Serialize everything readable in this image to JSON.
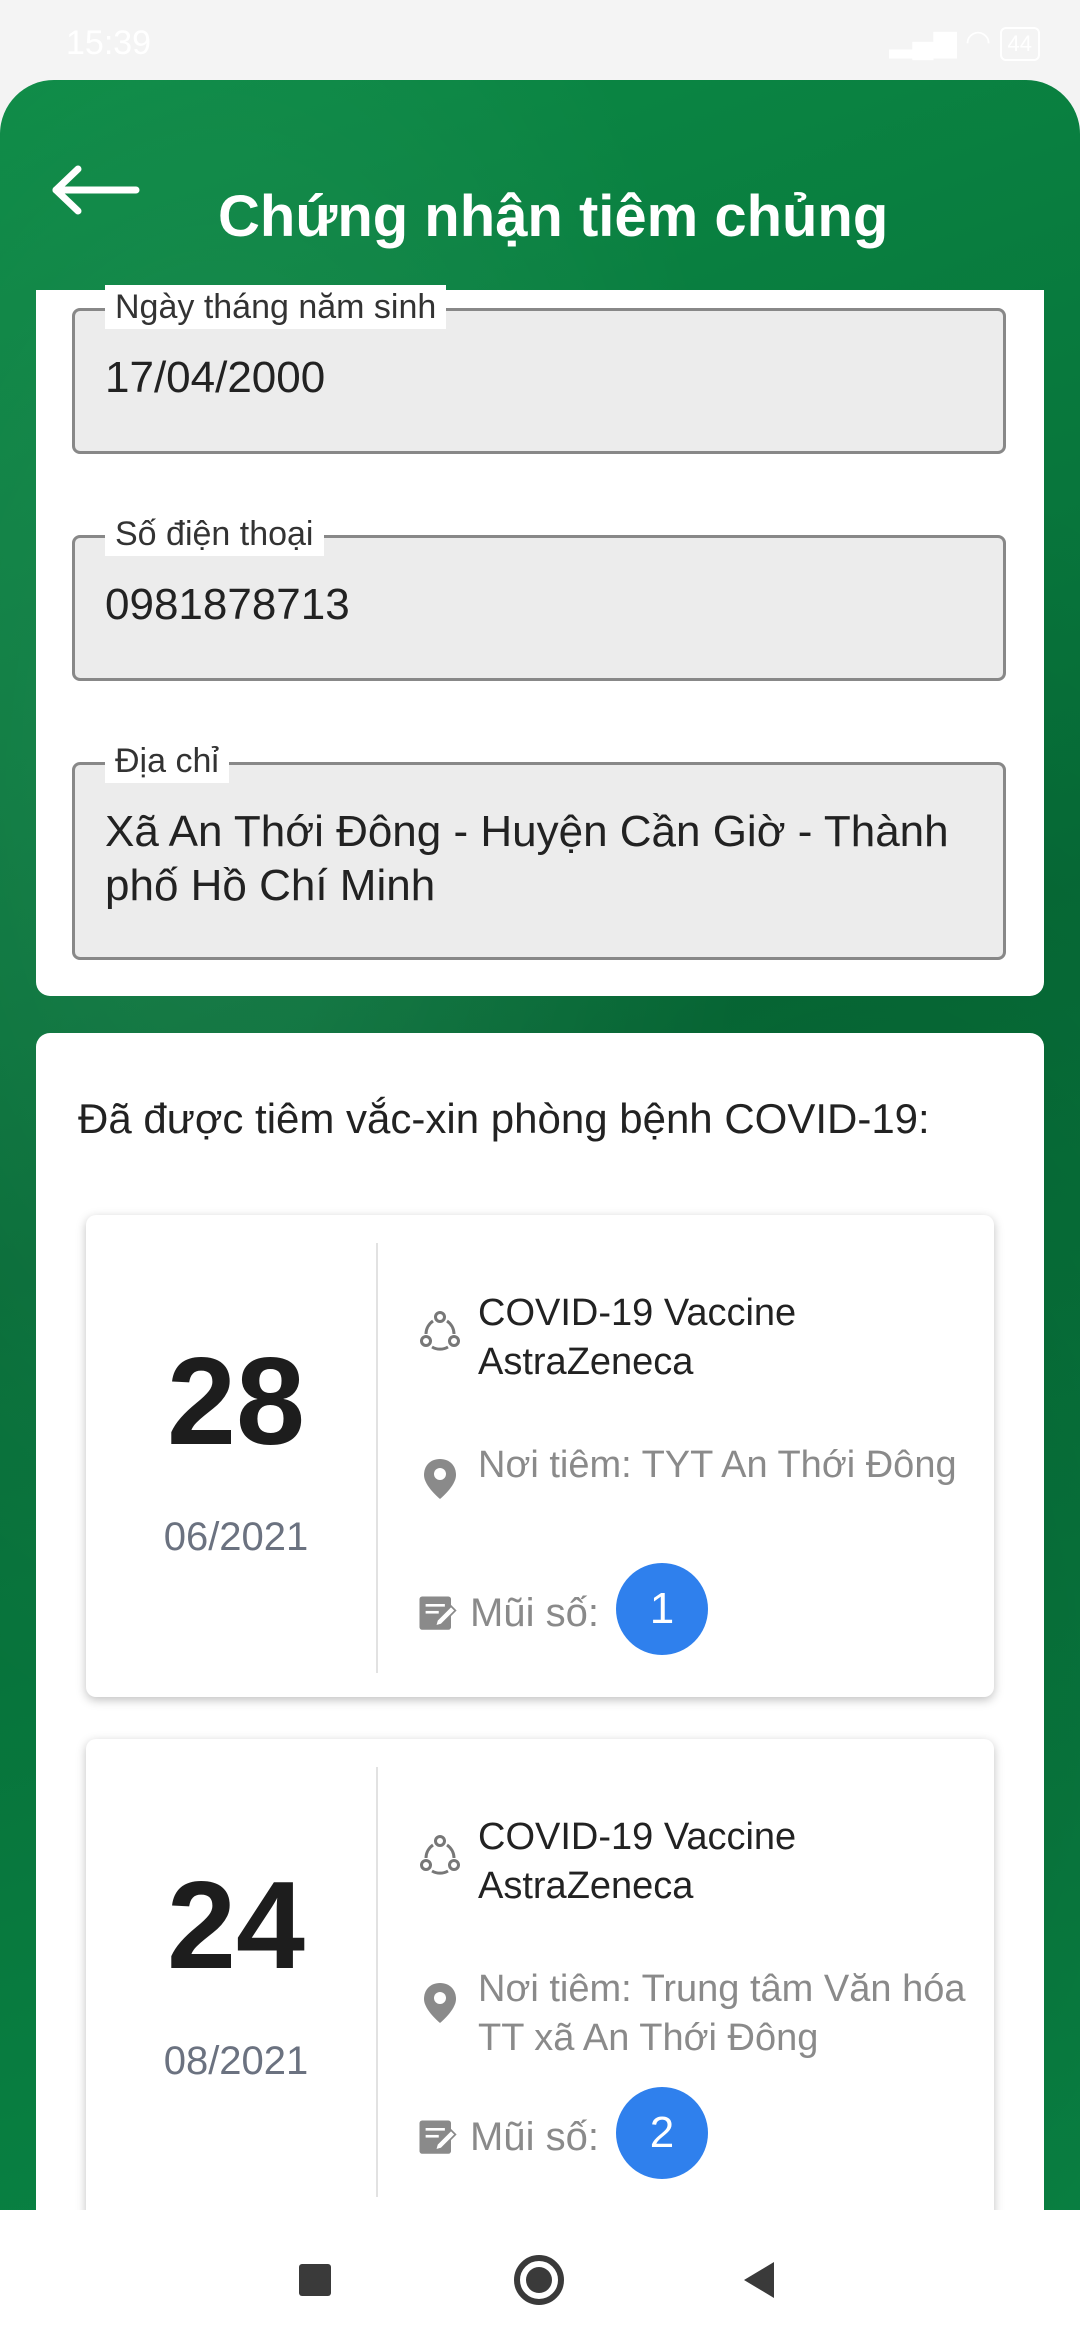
{
  "status_bar": {
    "time": "15:39",
    "battery": "44"
  },
  "header": {
    "title": "Chứng nhận tiêm chủng",
    "back_icon": "arrow-left-icon"
  },
  "personal_info": {
    "dob": {
      "label": "Ngày tháng năm sinh",
      "value": "17/04/2000"
    },
    "phone": {
      "label": "Số điện thoại",
      "value": "0981878713"
    },
    "address": {
      "label": "Địa chỉ",
      "value": "Xã An Thới Đông - Huyện Cần Giờ - Thành phố Hồ Chí Minh"
    }
  },
  "vaccination": {
    "heading": "Đã được tiêm vắc-xin phòng bệnh COVID-19:",
    "doses": [
      {
        "day": "28",
        "month_year": "06/2021",
        "vaccine": "COVID-19 Vaccine AstraZeneca",
        "location": "Nơi tiêm: TYT An Thới Đông",
        "dose_label": "Mũi số:",
        "dose_number": "1"
      },
      {
        "day": "24",
        "month_year": "08/2021",
        "vaccine": "COVID-19 Vaccine AstraZeneca",
        "location": "Nơi tiêm: Trung tâm Văn hóa TT xã An Thới Đông",
        "dose_label": "Mũi số:",
        "dose_number": "2"
      }
    ]
  },
  "colors": {
    "green": "#0b8a45",
    "badge_blue": "#2f80ed"
  },
  "nav": {
    "icons": [
      "recent-apps-icon",
      "home-icon",
      "back-triangle-icon"
    ]
  }
}
